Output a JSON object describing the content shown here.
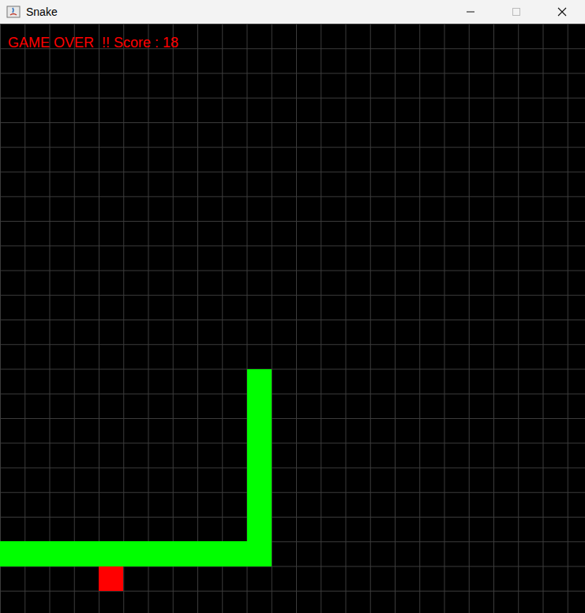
{
  "window": {
    "title": "Snake"
  },
  "message": "GAME OVER  !! Score : 18",
  "snake": {
    "cells": [
      {
        "col": 10,
        "row": 14
      },
      {
        "col": 10,
        "row": 15
      },
      {
        "col": 10,
        "row": 16
      },
      {
        "col": 10,
        "row": 17
      },
      {
        "col": 10,
        "row": 18
      },
      {
        "col": 10,
        "row": 19
      },
      {
        "col": 10,
        "row": 20
      },
      {
        "col": 10,
        "row": 21
      },
      {
        "col": 9,
        "row": 21
      },
      {
        "col": 8,
        "row": 21
      },
      {
        "col": 7,
        "row": 21
      },
      {
        "col": 6,
        "row": 21
      },
      {
        "col": 5,
        "row": 21
      },
      {
        "col": 4,
        "row": 21
      },
      {
        "col": 3,
        "row": 21
      },
      {
        "col": 2,
        "row": 21
      },
      {
        "col": 1,
        "row": 21
      },
      {
        "col": 0,
        "row": 21
      }
    ]
  },
  "food": {
    "col": 4,
    "row": 22
  }
}
